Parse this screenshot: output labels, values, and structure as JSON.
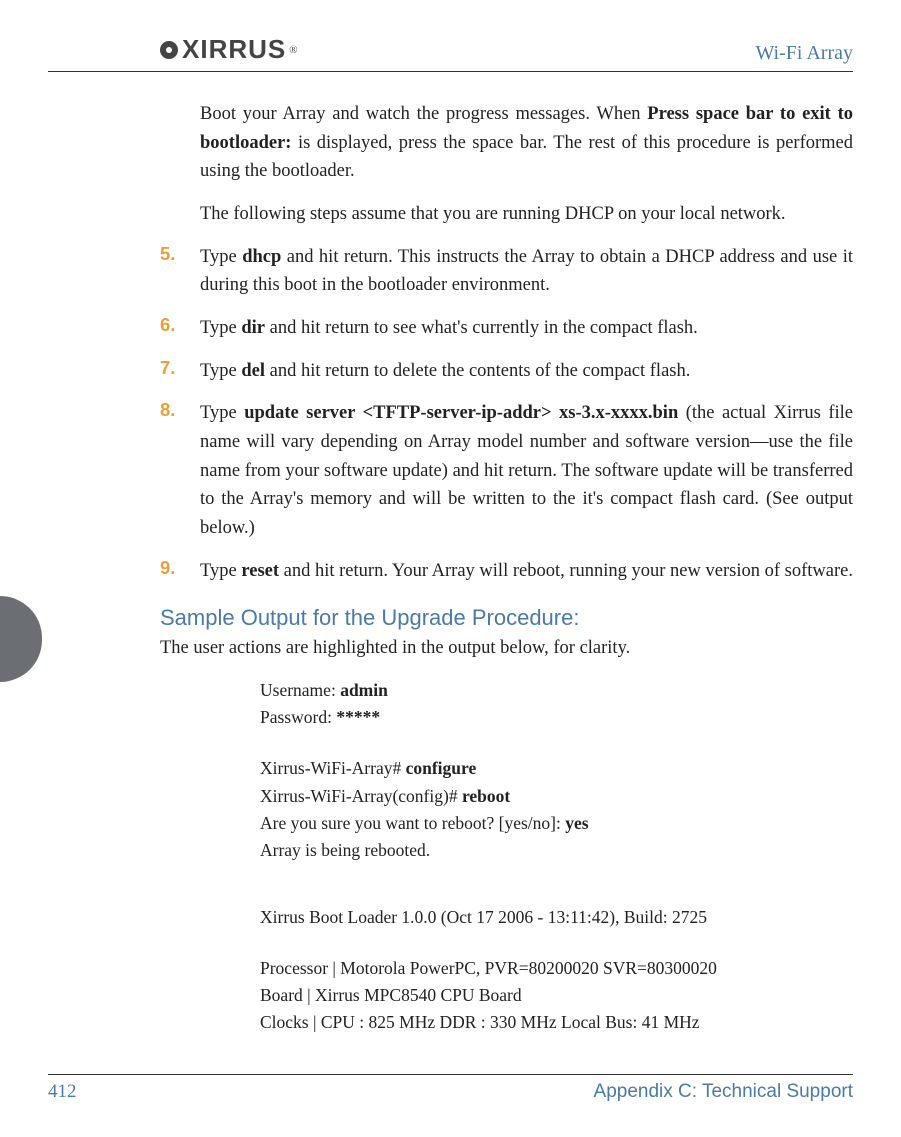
{
  "header": {
    "logo_text": "XIRRUS",
    "title": "Wi-Fi Array"
  },
  "intro": {
    "p1_a": "Boot your Array and watch the progress messages. When ",
    "p1_bold": "Press space bar to exit to bootloader:",
    "p1_b": " is displayed, press the space bar. The rest of this procedure is performed using the bootloader.",
    "p2": "The following steps assume that you are running DHCP on your local network."
  },
  "steps": [
    {
      "num": "5.",
      "parts": [
        {
          "t": "Type "
        },
        {
          "t": "dhcp",
          "b": true
        },
        {
          "t": " and hit return. This instructs the Array to obtain a DHCP address and use it during this boot in the bootloader environment."
        }
      ]
    },
    {
      "num": "6.",
      "parts": [
        {
          "t": "Type "
        },
        {
          "t": "dir",
          "b": true
        },
        {
          "t": " and hit return to see what's currently in the compact flash."
        }
      ]
    },
    {
      "num": "7.",
      "parts": [
        {
          "t": "Type "
        },
        {
          "t": "del",
          "b": true
        },
        {
          "t": " and hit return to delete the contents of the compact flash."
        }
      ]
    },
    {
      "num": "8.",
      "parts": [
        {
          "t": "Type "
        },
        {
          "t": "update server <TFTP-server-ip-addr> xs-3.x-xxxx.bin",
          "b": true
        },
        {
          "t": " (the actual Xirrus file name will vary depending on Array model number and software version—use the file name from your software update) and hit return. The software update will be transferred to the Array's memory and will be written to the it's compact flash card. (See output below.)"
        }
      ]
    },
    {
      "num": "9.",
      "parts": [
        {
          "t": "Type "
        },
        {
          "t": "reset",
          "b": true
        },
        {
          "t": " and hit return. Your Array will reboot, running your new version of software."
        }
      ]
    }
  ],
  "sample": {
    "heading": "Sample Output for the Upgrade Procedure:",
    "intro": "The user actions are highlighted in the output below, for clarity.",
    "lines": [
      {
        "pre": "Username: ",
        "bold": "admin"
      },
      {
        "pre": "Password: ",
        "bold": "*****"
      },
      {
        "gap": true
      },
      {
        "pre": "Xirrus-WiFi-Array# ",
        "bold": "configure"
      },
      {
        "pre": "Xirrus-WiFi-Array(config)# ",
        "bold": "reboot"
      },
      {
        "pre": "Are you sure you want to reboot? [yes/no]: ",
        "bold": "yes"
      },
      {
        "pre": "Array is being rebooted."
      },
      {
        "biggap": true
      },
      {
        "pre": "Xirrus Boot Loader 1.0.0 (Oct 17 2006 - 13:11:42), Build: 2725"
      },
      {
        "gap": true
      },
      {
        "pre": "Processor   |  Motorola PowerPC, PVR=80200020 SVR=80300020"
      },
      {
        "pre": "Board        |  Xirrus MPC8540 CPU Board"
      },
      {
        "pre": "Clocks       |  CPU : 825 MHz   DDR : 330 MHz   Local Bus: 41 MHz"
      }
    ]
  },
  "footer": {
    "page": "412",
    "section": "Appendix C: Technical Support"
  }
}
